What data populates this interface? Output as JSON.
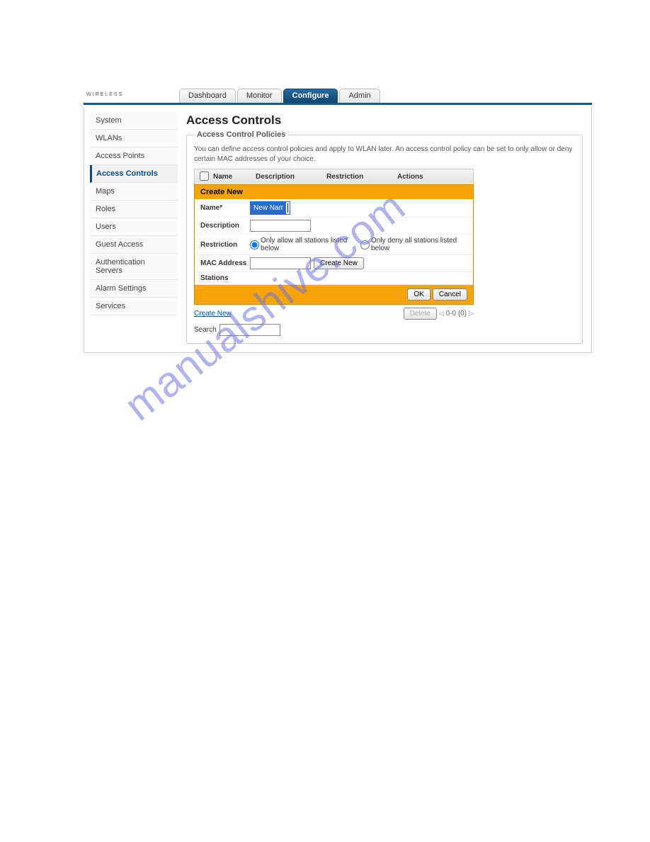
{
  "logo": {
    "brand_sub": "WIRELESS"
  },
  "tabs": {
    "dashboard": "Dashboard",
    "monitor": "Monitor",
    "configure": "Configure",
    "admin": "Admin"
  },
  "sidebar": {
    "items": [
      {
        "label": "System"
      },
      {
        "label": "WLANs"
      },
      {
        "label": "Access Points"
      },
      {
        "label": "Access Controls"
      },
      {
        "label": "Maps"
      },
      {
        "label": "Roles"
      },
      {
        "label": "Users"
      },
      {
        "label": "Guest Access"
      },
      {
        "label": "Authentication Servers"
      },
      {
        "label": "Alarm Settings"
      },
      {
        "label": "Services"
      }
    ]
  },
  "page": {
    "title": "Access Controls",
    "legend": "Access Control Policies",
    "description": "You can define access control policies and apply to WLAN later. An access control policy can be set to only allow or deny certain MAC addresses of your choice."
  },
  "grid": {
    "col_name": "Name",
    "col_desc": "Description",
    "col_restriction": "Restriction",
    "col_actions": "Actions"
  },
  "panel": {
    "title": "Create New",
    "name_label": "Name*",
    "name_value": "New Name",
    "desc_label": "Description",
    "desc_value": "",
    "restr_label": "Restriction",
    "restr_allow": "Only allow all stations listed below",
    "restr_deny": "Only deny all stations listed below",
    "mac_label": "MAC Address",
    "mac_value": "",
    "mac_create": "Create New",
    "stations_label": "Stations",
    "ok": "OK",
    "cancel": "Cancel"
  },
  "footer": {
    "create_new": "Create New",
    "delete": "Delete",
    "pager": "0-0 (0)",
    "search_label": "Search",
    "search_value": ""
  },
  "watermark": "manualshive.com"
}
